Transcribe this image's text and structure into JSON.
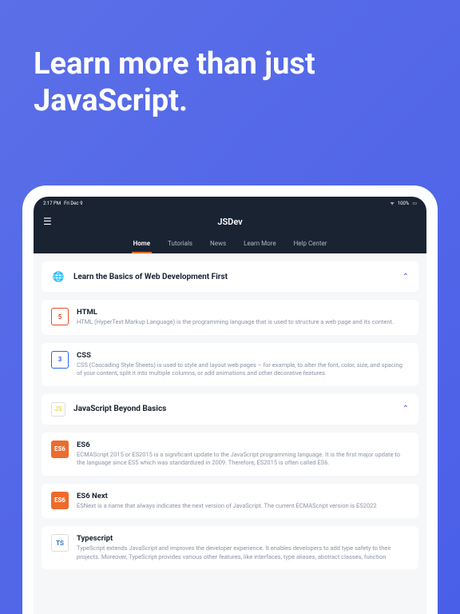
{
  "hero": "Learn more than just JavaScript.",
  "status": {
    "time": "2:17 PM",
    "date": "Fri Dec 9",
    "battery": "100%"
  },
  "nav": {
    "title": "JSDev",
    "tabs": [
      "Home",
      "Tutorials",
      "News",
      "Learn More",
      "Help Center"
    ]
  },
  "sections": [
    {
      "title": "Learn the Basics of Web Development First",
      "cards": [
        {
          "icon": "5",
          "iconClass": "icon-html",
          "title": "HTML",
          "desc": "HTML (HyperText Markup Language) is the programming language that is used to structure a web page and its content."
        },
        {
          "icon": "3",
          "iconClass": "icon-css",
          "title": "CSS",
          "desc": "CSS (Cascading Style Sheets) is used to style and layout web pages – for example, to alter the font, color, size, and spacing of your content, split it into multiple columns, or add animations and other decorative features."
        }
      ]
    },
    {
      "title": "JavaScript Beyond Basics",
      "cards": [
        {
          "icon": "ES6",
          "iconClass": "icon-es6",
          "title": "ES6",
          "desc": "ECMAScript 2015 or ES2015 is a significant update to the JavaScript programming language. It is the first major update to the language since ES5 which was standardized in 2009. Therefore, ES2015 is often called ES6."
        },
        {
          "icon": "ES6",
          "iconClass": "icon-es6",
          "title": "ES6 Next",
          "desc": "ESNext is a name that always indicates the next version of JavaScript. The current ECMAScript version is ES2022"
        },
        {
          "icon": "TS",
          "iconClass": "icon-ts",
          "title": "Typescript",
          "desc": "TypeScript extends JavaScript and improves the developer experience. It enables developers to add type safety to their projects. Moreover, TypeScript provides various other features, like interfaces, type aliases, abstract classes, function"
        }
      ]
    }
  ]
}
